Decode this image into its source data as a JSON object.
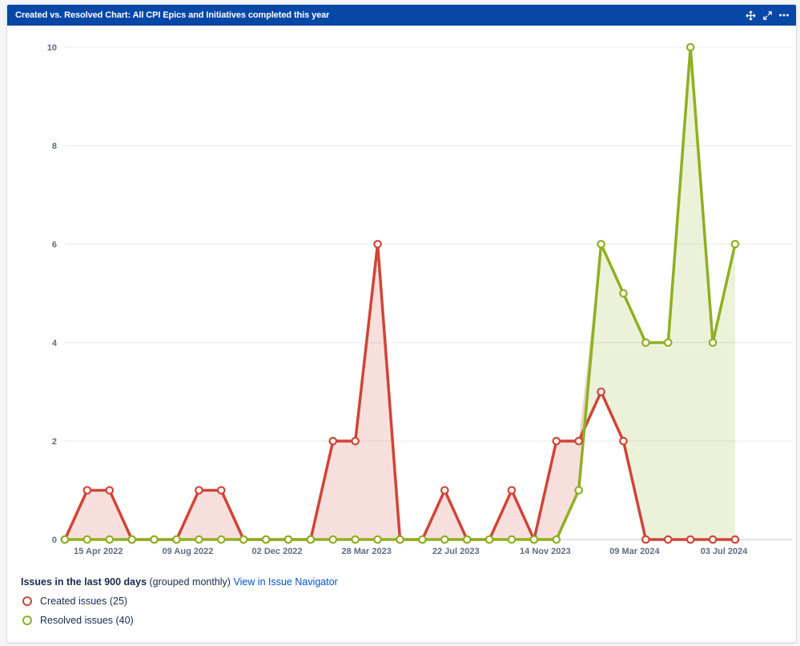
{
  "header": {
    "title": "Created vs. Resolved Chart: All CPI Epics and Initiatives completed this year"
  },
  "footer": {
    "heading": "Issues in the last 900 days",
    "grouping": "(grouped monthly)",
    "link_label": "View in Issue Navigator"
  },
  "colors": {
    "created": "#d04437",
    "resolved": "#8eb021",
    "title_bar": "#0747a6"
  },
  "chart_data": {
    "type": "area",
    "x_tick_labels": [
      "15 Apr 2022",
      "09 Aug 2022",
      "02 Dec 2022",
      "28 Mar 2023",
      "22 Jul 2023",
      "14 Nov 2023",
      "09 Mar 2024",
      "03 Jul 2024"
    ],
    "y_ticks": [
      0,
      2,
      4,
      6,
      8,
      10
    ],
    "ylim": [
      0,
      10
    ],
    "grid": true,
    "legend_position": "bottom-left",
    "series": [
      {
        "name": "Created issues (25)",
        "values": [
          0,
          1,
          1,
          0,
          0,
          0,
          1,
          1,
          0,
          0,
          0,
          0,
          2,
          2,
          6,
          0,
          0,
          1,
          0,
          0,
          1,
          0,
          2,
          2,
          3,
          2,
          0,
          0,
          0,
          0,
          0
        ]
      },
      {
        "name": "Resolved issues (40)",
        "values": [
          0,
          0,
          0,
          0,
          0,
          0,
          0,
          0,
          0,
          0,
          0,
          0,
          0,
          0,
          0,
          0,
          0,
          0,
          0,
          0,
          0,
          0,
          0,
          1,
          6,
          5,
          4,
          4,
          10,
          4,
          6
        ]
      }
    ]
  }
}
